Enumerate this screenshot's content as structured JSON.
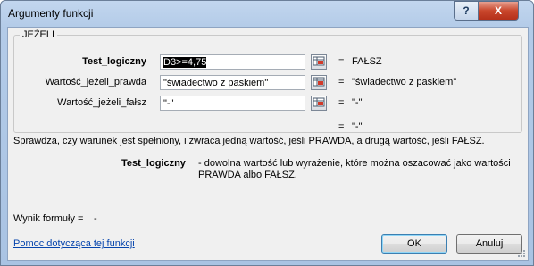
{
  "window": {
    "title": "Argumenty funkcji",
    "help_symbol": "?",
    "close_symbol": "X"
  },
  "group": {
    "title": "JEŻELI",
    "args": [
      {
        "label": "Test_logiczny",
        "value": "D3>=4,75",
        "result": "FAŁSZ",
        "bold": true,
        "selected": true
      },
      {
        "label": "Wartość_jeżeli_prawda",
        "value": "\"świadectwo z paskiem\"",
        "result": "\"świadectwo z paskiem\"",
        "bold": false
      },
      {
        "label": "Wartość_jeżeli_fałsz",
        "value": "\"-\"",
        "result": "\"-\"",
        "bold": false
      }
    ]
  },
  "eq_sign": "=",
  "overall_result": "\"-\"",
  "description": "Sprawdza, czy warunek jest spełniony, i zwraca jedną wartość, jeśli PRAWDA, a drugą wartość, jeśli FAŁSZ.",
  "arg_help": {
    "name": "Test_logiczny",
    "text": "- dowolna wartość lub wyrażenie, które można oszacować jako wartości PRAWDA albo FAŁSZ."
  },
  "formula_result": {
    "label": "Wynik formuły =",
    "value": "-"
  },
  "help_link": "Pomoc dotycząca tej funkcji",
  "buttons": {
    "ok": "OK",
    "cancel": "Anuluj"
  },
  "icons": {
    "ref_button": "collapse-dialog-icon",
    "help": "question-icon",
    "close": "close-icon"
  }
}
